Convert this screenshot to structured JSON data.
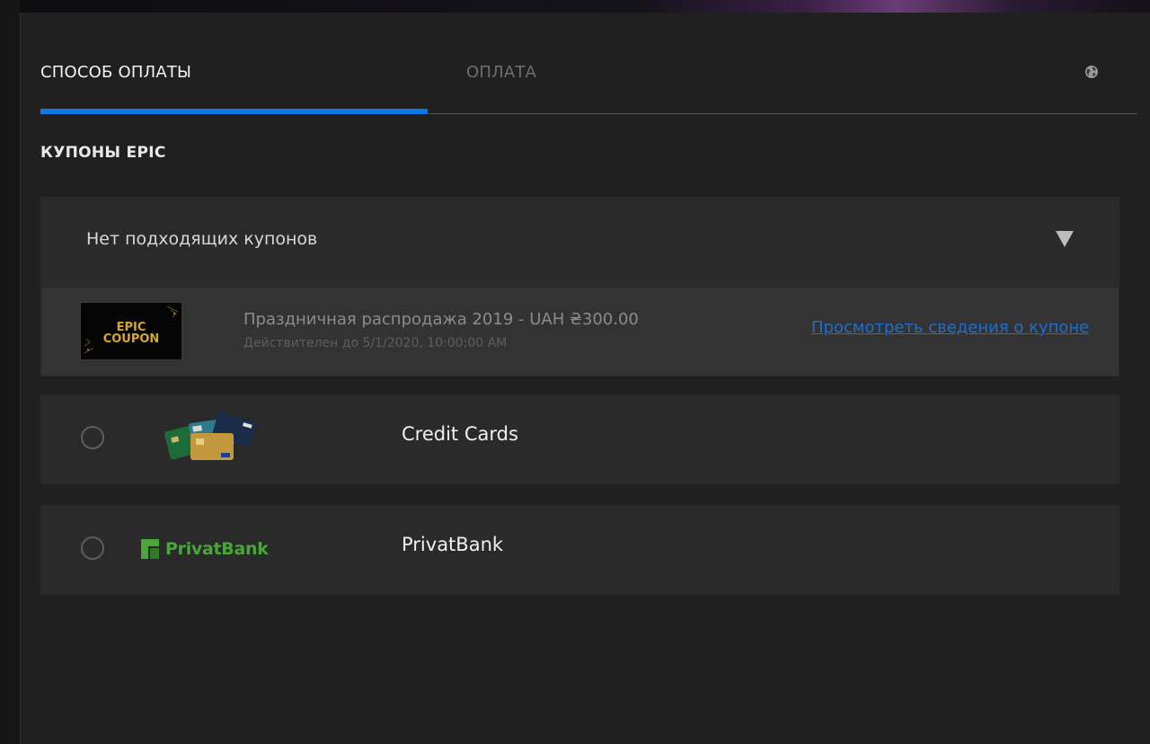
{
  "tabs": [
    {
      "label": "СПОСОБ ОПЛАТЫ",
      "active": true
    },
    {
      "label": "ОПЛАТА",
      "active": false
    }
  ],
  "section_title": "КУПОНЫ EPIC",
  "coupon_select": {
    "value": "Нет подходящих купонов"
  },
  "coupon": {
    "badge_text": [
      "EPIC",
      "COUPON"
    ],
    "name": "Праздничная распродажа 2019 - UAH ₴300.00",
    "valid_until": "Действителен до 5/1/2020, 10:00:00 AM",
    "details_link": "Просмотреть сведения о купоне"
  },
  "payment_methods": [
    {
      "label": "Credit Cards",
      "selected": false,
      "icon": "credit-cards-icon"
    },
    {
      "label": "PrivatBank",
      "selected": false,
      "icon": "privatbank-logo",
      "logo_text": "PrivatBank"
    }
  ],
  "colors": {
    "accent": "#0f78e6",
    "link": "#1f6fd0",
    "privatbank_green": "#4aa53a",
    "coupon_gold": "#d9a82a"
  }
}
